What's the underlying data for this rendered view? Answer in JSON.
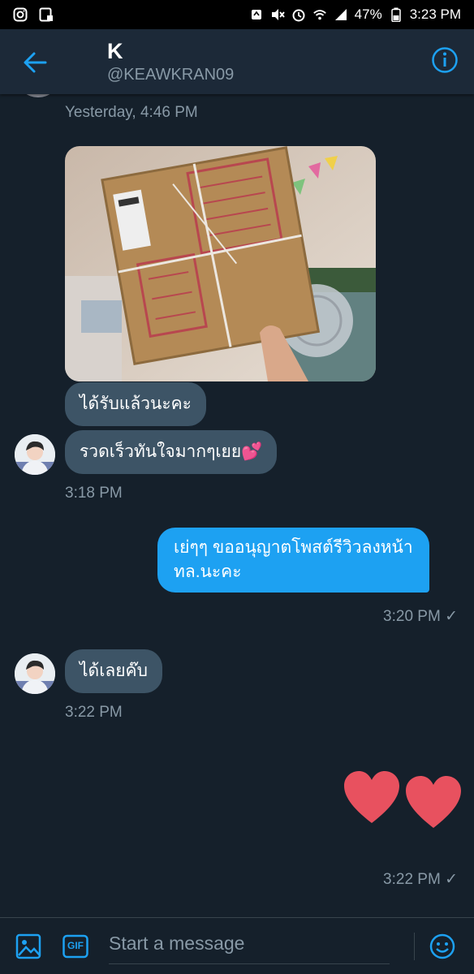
{
  "status_bar": {
    "battery": "47%",
    "time": "3:23 PM",
    "icons": [
      "instagram-icon",
      "image-lock-icon",
      "recycle-icon",
      "mute-icon",
      "alarm-icon",
      "wifi-icon",
      "signal-icon",
      "battery-icon"
    ]
  },
  "header": {
    "name": "K",
    "handle": "@KEAWKRAN09",
    "back_icon": "arrow-left-icon",
    "info_icon": "info-icon"
  },
  "messages": {
    "ts_yesterday": "Yesterday, 4:46 PM",
    "in_1": "ได้รับแล้วนะคะ",
    "in_2": "รวดเร็วทันใจมากๆเยย",
    "in_2_emoji": "💕",
    "ts_1": "3:18 PM",
    "out_1_line1": "เย่ๆๆ ขออนุญาตโพสต์รีวิวลงหน้า",
    "out_1_line2": "ทล.นะคะ",
    "ts_2": "3:20 PM",
    "in_3": "ได้เลยค๊บ",
    "ts_3": "3:22 PM",
    "ts_4": "3:22 PM",
    "check": "✓"
  },
  "composer": {
    "placeholder": "Start a message",
    "gif_label": "GIF"
  },
  "colors": {
    "background": "#15202b",
    "header": "#1c2938",
    "accent": "#1da1f2",
    "bubble_in": "#3d5466",
    "muted": "#8899a6",
    "heart": "#e8515f"
  }
}
